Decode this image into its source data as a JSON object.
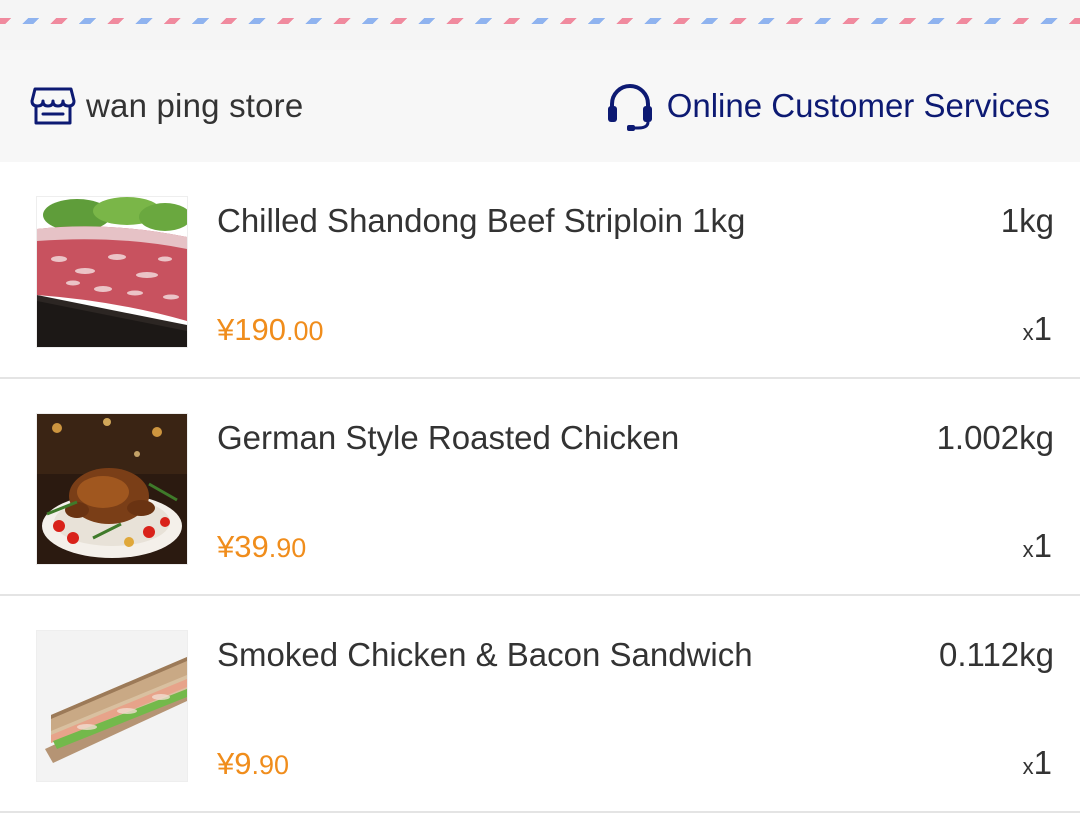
{
  "store": {
    "name": "wan ping store",
    "service_label": "Online Customer Services"
  },
  "icons": {
    "store": "store-icon",
    "service": "headset-icon"
  },
  "colors": {
    "price": "#f08d1c",
    "service_link": "#0d1a73",
    "icon": "#0d1a73"
  },
  "items": [
    {
      "name": "Chilled Shandong Beef Striploin 1kg",
      "weight": "1kg",
      "price_currency": "¥",
      "price_int": "190",
      "price_dec": ".00",
      "qty_prefix": "x",
      "qty": "1",
      "image": "beef-steak-image"
    },
    {
      "name": "German Style Roasted Chicken",
      "weight": "1.002kg",
      "price_currency": "¥",
      "price_int": "39",
      "price_dec": ".90",
      "qty_prefix": "x",
      "qty": "1",
      "image": "roast-chicken-image"
    },
    {
      "name": "Smoked Chicken & Bacon Sandwich",
      "weight": "0.112kg",
      "price_currency": "¥",
      "price_int": "9",
      "price_dec": ".90",
      "qty_prefix": "x",
      "qty": "1",
      "image": "sandwich-image"
    }
  ]
}
